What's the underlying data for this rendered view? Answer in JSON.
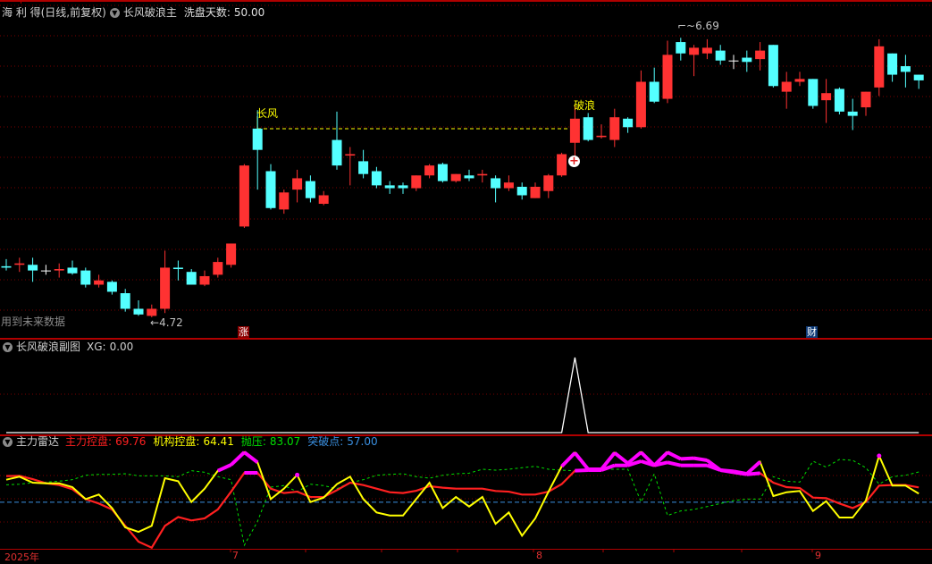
{
  "header": {
    "stock": "海 利 得(日线,前复权)",
    "indicator": "长风破浪主",
    "param_label": "洗盘天数:",
    "param_value": "50.00"
  },
  "main_chart": {
    "high_label": "6.69",
    "low_label": "4.72",
    "marker_changfeng": "长风",
    "marker_polang": "破浪",
    "future_data_note": "用到未来数据",
    "badge_zhang": "涨",
    "badge_cai": "财",
    "colors": {
      "up": "#ff3232",
      "down": "#54ffff",
      "flat": "#ffffff",
      "marker": "#ffff00"
    },
    "candles": [
      [
        5.08,
        5.07,
        5.13,
        5.05
      ],
      [
        5.09,
        5.1,
        5.14,
        5.04
      ],
      [
        5.09,
        5.05,
        5.14,
        4.97
      ],
      [
        5.05,
        5.05,
        5.09,
        5.02
      ],
      [
        5.05,
        5.06,
        5.1,
        5.0
      ],
      [
        5.07,
        5.03,
        5.12,
        5.02
      ],
      [
        5.05,
        4.95,
        5.07,
        4.93
      ],
      [
        4.95,
        4.98,
        5.02,
        4.93
      ],
      [
        4.97,
        4.9,
        4.98,
        4.88
      ],
      [
        4.89,
        4.78,
        4.92,
        4.76
      ],
      [
        4.78,
        4.74,
        4.84,
        4.73
      ],
      [
        4.73,
        4.78,
        4.81,
        4.72
      ],
      [
        4.78,
        5.07,
        5.19,
        4.75
      ],
      [
        5.07,
        5.06,
        5.12,
        4.98
      ],
      [
        5.04,
        4.95,
        5.06,
        4.95
      ],
      [
        4.95,
        5.01,
        5.05,
        4.94
      ],
      [
        5.02,
        5.11,
        5.14,
        5.0
      ],
      [
        5.09,
        5.24,
        5.24,
        5.07
      ],
      [
        5.36,
        5.79,
        5.8,
        5.35
      ],
      [
        6.05,
        5.9,
        6.18,
        5.62
      ],
      [
        5.75,
        5.49,
        5.8,
        5.48
      ],
      [
        5.48,
        5.6,
        5.62,
        5.45
      ],
      [
        5.62,
        5.7,
        5.76,
        5.53
      ],
      [
        5.68,
        5.56,
        5.72,
        5.53
      ],
      [
        5.52,
        5.58,
        5.61,
        5.51
      ],
      [
        5.97,
        5.79,
        6.17,
        5.76
      ],
      [
        5.86,
        5.87,
        5.92,
        5.65
      ],
      [
        5.82,
        5.73,
        5.9,
        5.7
      ],
      [
        5.75,
        5.65,
        5.78,
        5.63
      ],
      [
        5.65,
        5.63,
        5.68,
        5.59
      ],
      [
        5.65,
        5.63,
        5.67,
        5.59
      ],
      [
        5.63,
        5.72,
        5.72,
        5.61
      ],
      [
        5.72,
        5.79,
        5.8,
        5.7
      ],
      [
        5.8,
        5.68,
        5.81,
        5.67
      ],
      [
        5.68,
        5.73,
        5.73,
        5.67
      ],
      [
        5.72,
        5.7,
        5.76,
        5.68
      ],
      [
        5.72,
        5.73,
        5.76,
        5.67
      ],
      [
        5.7,
        5.63,
        5.72,
        5.53
      ],
      [
        5.63,
        5.67,
        5.72,
        5.61
      ],
      [
        5.64,
        5.58,
        5.67,
        5.55
      ],
      [
        5.56,
        5.64,
        5.67,
        5.56
      ],
      [
        5.61,
        5.72,
        5.73,
        5.56
      ],
      [
        5.72,
        5.87,
        5.88,
        5.71
      ],
      [
        5.95,
        6.12,
        6.21,
        5.85
      ],
      [
        6.13,
        5.97,
        6.16,
        5.96
      ],
      [
        5.99,
        6.0,
        6.08,
        5.98
      ],
      [
        5.97,
        6.13,
        6.19,
        5.92
      ],
      [
        6.12,
        6.06,
        6.13,
        6.02
      ],
      [
        6.06,
        6.38,
        6.46,
        6.05
      ],
      [
        6.38,
        6.24,
        6.48,
        6.23
      ],
      [
        6.26,
        6.57,
        6.67,
        6.23
      ],
      [
        6.66,
        6.58,
        6.69,
        6.53
      ],
      [
        6.57,
        6.62,
        6.64,
        6.42
      ],
      [
        6.58,
        6.62,
        6.68,
        6.54
      ],
      [
        6.6,
        6.53,
        6.64,
        6.5
      ],
      [
        6.53,
        6.53,
        6.57,
        6.47
      ],
      [
        6.55,
        6.52,
        6.6,
        6.45
      ],
      [
        6.54,
        6.6,
        6.66,
        6.46
      ],
      [
        6.64,
        6.35,
        6.64,
        6.34
      ],
      [
        6.31,
        6.38,
        6.45,
        6.19
      ],
      [
        6.38,
        6.4,
        6.45,
        6.35
      ],
      [
        6.4,
        6.21,
        6.4,
        6.19
      ],
      [
        6.25,
        6.3,
        6.4,
        6.09
      ],
      [
        6.33,
        6.17,
        6.34,
        6.15
      ],
      [
        6.17,
        6.14,
        6.26,
        6.04
      ],
      [
        6.2,
        6.31,
        6.31,
        6.14
      ],
      [
        6.34,
        6.63,
        6.68,
        6.28
      ],
      [
        6.58,
        6.43,
        6.58,
        6.38
      ],
      [
        6.49,
        6.45,
        6.57,
        6.34
      ],
      [
        6.43,
        6.39,
        6.43,
        6.33
      ]
    ]
  },
  "sub_chart1": {
    "title": "长风破浪副图",
    "xg_label": "XG:",
    "xg_value": "0.00",
    "xg_series": [
      0,
      0,
      0,
      0,
      0,
      0,
      0,
      0,
      0,
      0,
      0,
      0,
      0,
      0,
      0,
      0,
      0,
      0,
      0,
      0,
      0,
      0,
      0,
      0,
      0,
      0,
      0,
      0,
      0,
      0,
      0,
      0,
      0,
      0,
      0,
      0,
      0,
      0,
      0,
      0,
      0,
      0,
      0,
      1,
      0,
      0,
      0,
      0,
      0,
      0,
      0,
      0,
      0,
      0,
      0,
      0,
      0,
      0,
      0,
      0,
      0,
      0,
      0,
      0,
      0,
      0,
      0,
      0,
      0,
      0
    ]
  },
  "sub_chart2": {
    "title": "主力雷达",
    "legend": [
      {
        "label": "主力控盘:",
        "value": "69.76",
        "color": "#ff2020"
      },
      {
        "label": "机构控盘:",
        "value": "64.41",
        "color": "#ffff00"
      },
      {
        "label": "抛压:",
        "value": "83.07",
        "color": "#00e000"
      },
      {
        "label": "突破点:",
        "value": "57.00",
        "color": "#3a8fe0"
      }
    ],
    "highlight_color": "#ff00ff",
    "highlight_threshold": 80,
    "breakout_level": 57,
    "zhuli": [
      79.5,
      79.7,
      76.9,
      73.3,
      71.8,
      68.2,
      59.7,
      55.9,
      50.8,
      36.7,
      23.1,
      17.9,
      36.7,
      44.3,
      41.3,
      43.1,
      50.8,
      66.1,
      82.3,
      82.3,
      68.7,
      64.9,
      66.1,
      61.5,
      61.5,
      67.4,
      73.8,
      71.8,
      68.7,
      65.6,
      64.9,
      66.9,
      70.8,
      69.5,
      68.7,
      68.7,
      68.7,
      66.7,
      66.1,
      63.6,
      63.6,
      66.1,
      72.6,
      84.1,
      84.6,
      84.6,
      88.7,
      88.7,
      92.3,
      88.7,
      91.3,
      88.7,
      88.7,
      88.7,
      84.6,
      82.8,
      81.0,
      82.0,
      73.8,
      70.0,
      69.2,
      61.0,
      60.5,
      55.9,
      52.0,
      57.2,
      71.3,
      71.8,
      71.8,
      69.76
    ],
    "jigou": [
      76.4,
      79.0,
      73.8,
      73.3,
      73.3,
      70.0,
      59.7,
      63.6,
      52.0,
      35.4,
      31.5,
      36.7,
      77.7,
      75.1,
      57.2,
      68.7,
      84.1,
      89.2,
      100,
      91.3,
      59.7,
      68.7,
      80.5,
      57.2,
      61.0,
      72.6,
      79.0,
      59.7,
      48.2,
      45.6,
      45.6,
      59.7,
      73.8,
      52.0,
      61.5,
      53.3,
      61.5,
      38.4,
      48.2,
      28.2,
      43.1,
      66.1,
      87.9,
      99.5,
      85.4,
      85.4,
      99.5,
      90.5,
      100,
      88.7,
      100,
      94.3,
      94.9,
      93.1,
      84.6,
      83.6,
      81.5,
      91.8,
      62.3,
      65.6,
      66.7,
      49.5,
      57.9,
      43.8,
      43.8,
      58.4,
      96.9,
      71.3,
      71.3,
      64.41
    ],
    "paoya": [
      72.0,
      72.5,
      73.8,
      74.3,
      75.1,
      76.4,
      80.2,
      81.0,
      81.0,
      81.5,
      79.7,
      79.7,
      79.7,
      79.0,
      84.1,
      82.8,
      79.0,
      76.4,
      20.0,
      40.5,
      70.0,
      71.3,
      66.1,
      72.5,
      71.3,
      68.7,
      73.8,
      76.4,
      80.2,
      81.0,
      81.5,
      79.0,
      77.7,
      80.2,
      81.5,
      82.0,
      85.4,
      84.6,
      85.4,
      86.7,
      87.9,
      85.4,
      84.6,
      84.1,
      85.4,
      85.4,
      85.4,
      85.4,
      57.2,
      81.5,
      45.6,
      49.5,
      50.8,
      53.3,
      55.9,
      58.4,
      59.7,
      59.7,
      79.0,
      75.1,
      74.3,
      92.3,
      87.2,
      93.8,
      93.1,
      86.7,
      72.6,
      79.0,
      80.2,
      83.07
    ]
  },
  "time_axis": {
    "labels": [
      "2025年",
      "7",
      "8",
      "9"
    ]
  }
}
